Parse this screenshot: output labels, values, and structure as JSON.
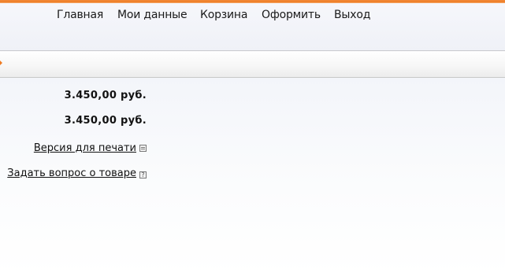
{
  "nav": {
    "items": [
      {
        "label": "Главная"
      },
      {
        "label": "Мои данные"
      },
      {
        "label": "Корзина"
      },
      {
        "label": "Оформить"
      },
      {
        "label": "Выход"
      }
    ]
  },
  "product": {
    "price_1": "3.450,00 руб.",
    "price_2": "3.450,00 руб.",
    "print_link": "Версия для печати",
    "ask_link": "Задать вопрос о товаре"
  },
  "icons": {
    "print": "print-icon",
    "question": "question-icon",
    "arrow": "arrow-right-icon"
  },
  "colors": {
    "accent": "#ee7b22",
    "nav_bg": "#f3f4f9",
    "separator": "#c8c8cc"
  }
}
